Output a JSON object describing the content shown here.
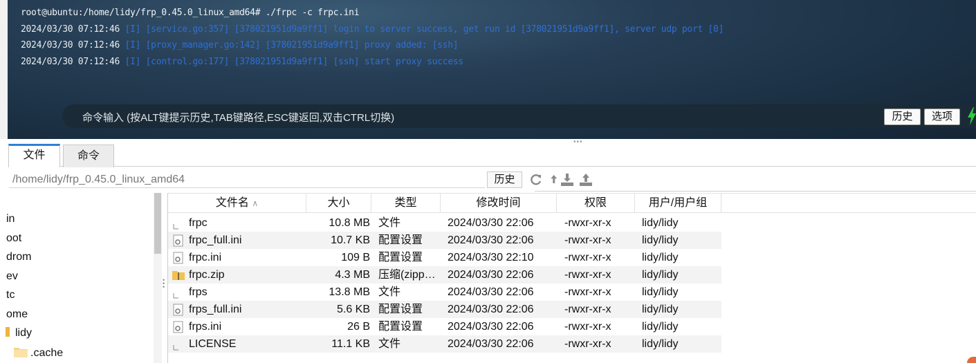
{
  "terminal": {
    "prompt": "root@ubuntu:/home/lidy/frp_0.45.0_linux_amd64# ./frpc -c frpc.ini",
    "logs": [
      {
        "ts": "2024/03/30 07:12:46",
        "msg": "[I] [service.go:357] [378021951d9a9ff1] login to server success, get run id [378021951d9a9ff1], server udp port [0]"
      },
      {
        "ts": "2024/03/30 07:12:46",
        "msg": "[I] [proxy_manager.go:142] [378021951d9a9ff1] proxy added: [ssh]"
      },
      {
        "ts": "2024/03/30 07:12:46",
        "msg": "[I] [control.go:177] [378021951d9a9ff1] [ssh] start proxy success"
      }
    ],
    "command_input_hint": "命令输入 (按ALT键提示历史,TAB键路径,ESC键返回,双击CTRL切换)",
    "history_button": "历史",
    "options_button": "选项",
    "log_color": "#2f6fd4",
    "bolt_color": "#2ecc40"
  },
  "tabs": {
    "files": "文件",
    "commands": "命令"
  },
  "path_bar": {
    "path": "/home/lidy/frp_0.45.0_linux_amd64",
    "history_button": "历史",
    "icons": [
      "refresh-icon",
      "up-arrow-icon",
      "download-icon",
      "upload-icon"
    ]
  },
  "tree": {
    "items": [
      "in",
      "oot",
      "drom",
      "ev",
      "tc",
      "ome",
      "lidy",
      ".cache"
    ]
  },
  "file_table": {
    "headers": {
      "name": "文件名",
      "size": "大小",
      "type": "类型",
      "mtime": "修改时间",
      "perm": "权限",
      "owner": "用户/用户组"
    },
    "rows": [
      {
        "icon": "file-icon",
        "name": "frpc",
        "size": "10.8 MB",
        "type": "文件",
        "mtime": "2024/03/30 22:06",
        "perm": "-rwxr-xr-x",
        "owner": "lidy/lidy"
      },
      {
        "icon": "config-file-icon",
        "name": "frpc_full.ini",
        "size": "10.7 KB",
        "type": "配置设置",
        "mtime": "2024/03/30 22:06",
        "perm": "-rwxr-xr-x",
        "owner": "lidy/lidy"
      },
      {
        "icon": "config-file-icon",
        "name": "frpc.ini",
        "size": "109 B",
        "type": "配置设置",
        "mtime": "2024/03/30 22:10",
        "perm": "-rwxr-xr-x",
        "owner": "lidy/lidy"
      },
      {
        "icon": "zip-icon",
        "name": "frpc.zip",
        "size": "4.3 MB",
        "type": "压缩(zipp…",
        "mtime": "2024/03/30 22:06",
        "perm": "-rwxr-xr-x",
        "owner": "lidy/lidy"
      },
      {
        "icon": "file-icon",
        "name": "frps",
        "size": "13.8 MB",
        "type": "文件",
        "mtime": "2024/03/30 22:06",
        "perm": "-rwxr-xr-x",
        "owner": "lidy/lidy"
      },
      {
        "icon": "config-file-icon",
        "name": "frps_full.ini",
        "size": "5.6 KB",
        "type": "配置设置",
        "mtime": "2024/03/30 22:06",
        "perm": "-rwxr-xr-x",
        "owner": "lidy/lidy"
      },
      {
        "icon": "config-file-icon",
        "name": "frps.ini",
        "size": "26 B",
        "type": "配置设置",
        "mtime": "2024/03/30 22:06",
        "perm": "-rwxr-xr-x",
        "owner": "lidy/lidy"
      },
      {
        "icon": "file-icon",
        "name": "LICENSE",
        "size": "11.1 KB",
        "type": "文件",
        "mtime": "2024/03/30 22:06",
        "perm": "-rwxr-xr-x",
        "owner": "lidy/lidy"
      }
    ]
  }
}
